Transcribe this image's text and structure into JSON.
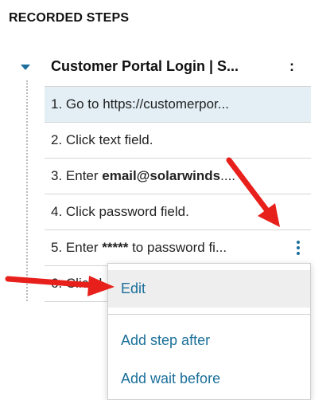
{
  "panel": {
    "title": "RECORDED STEPS"
  },
  "group": {
    "title": "Customer Portal Login | S...",
    "menu_glyph": ":"
  },
  "steps": [
    {
      "prefix": "1. Go to https://customerpor...",
      "bold": "",
      "suffix": ""
    },
    {
      "prefix": "2. Click text field.",
      "bold": "",
      "suffix": ""
    },
    {
      "prefix": "3. Enter ",
      "bold": "email@solarwinds",
      "suffix": "...."
    },
    {
      "prefix": "4. Click password field.",
      "bold": "",
      "suffix": ""
    },
    {
      "prefix": "5. Enter ",
      "bold": "*****",
      "suffix": " to password fi..."
    },
    {
      "prefix": "6. Click l",
      "bold": "",
      "suffix": ""
    }
  ],
  "context_menu": {
    "items": [
      "Edit",
      "Add step after",
      "Add wait before"
    ]
  },
  "colors": {
    "accent": "#1b6f9a",
    "selected_row": "#e3eff5",
    "annotation_arrow": "#e8201c"
  }
}
